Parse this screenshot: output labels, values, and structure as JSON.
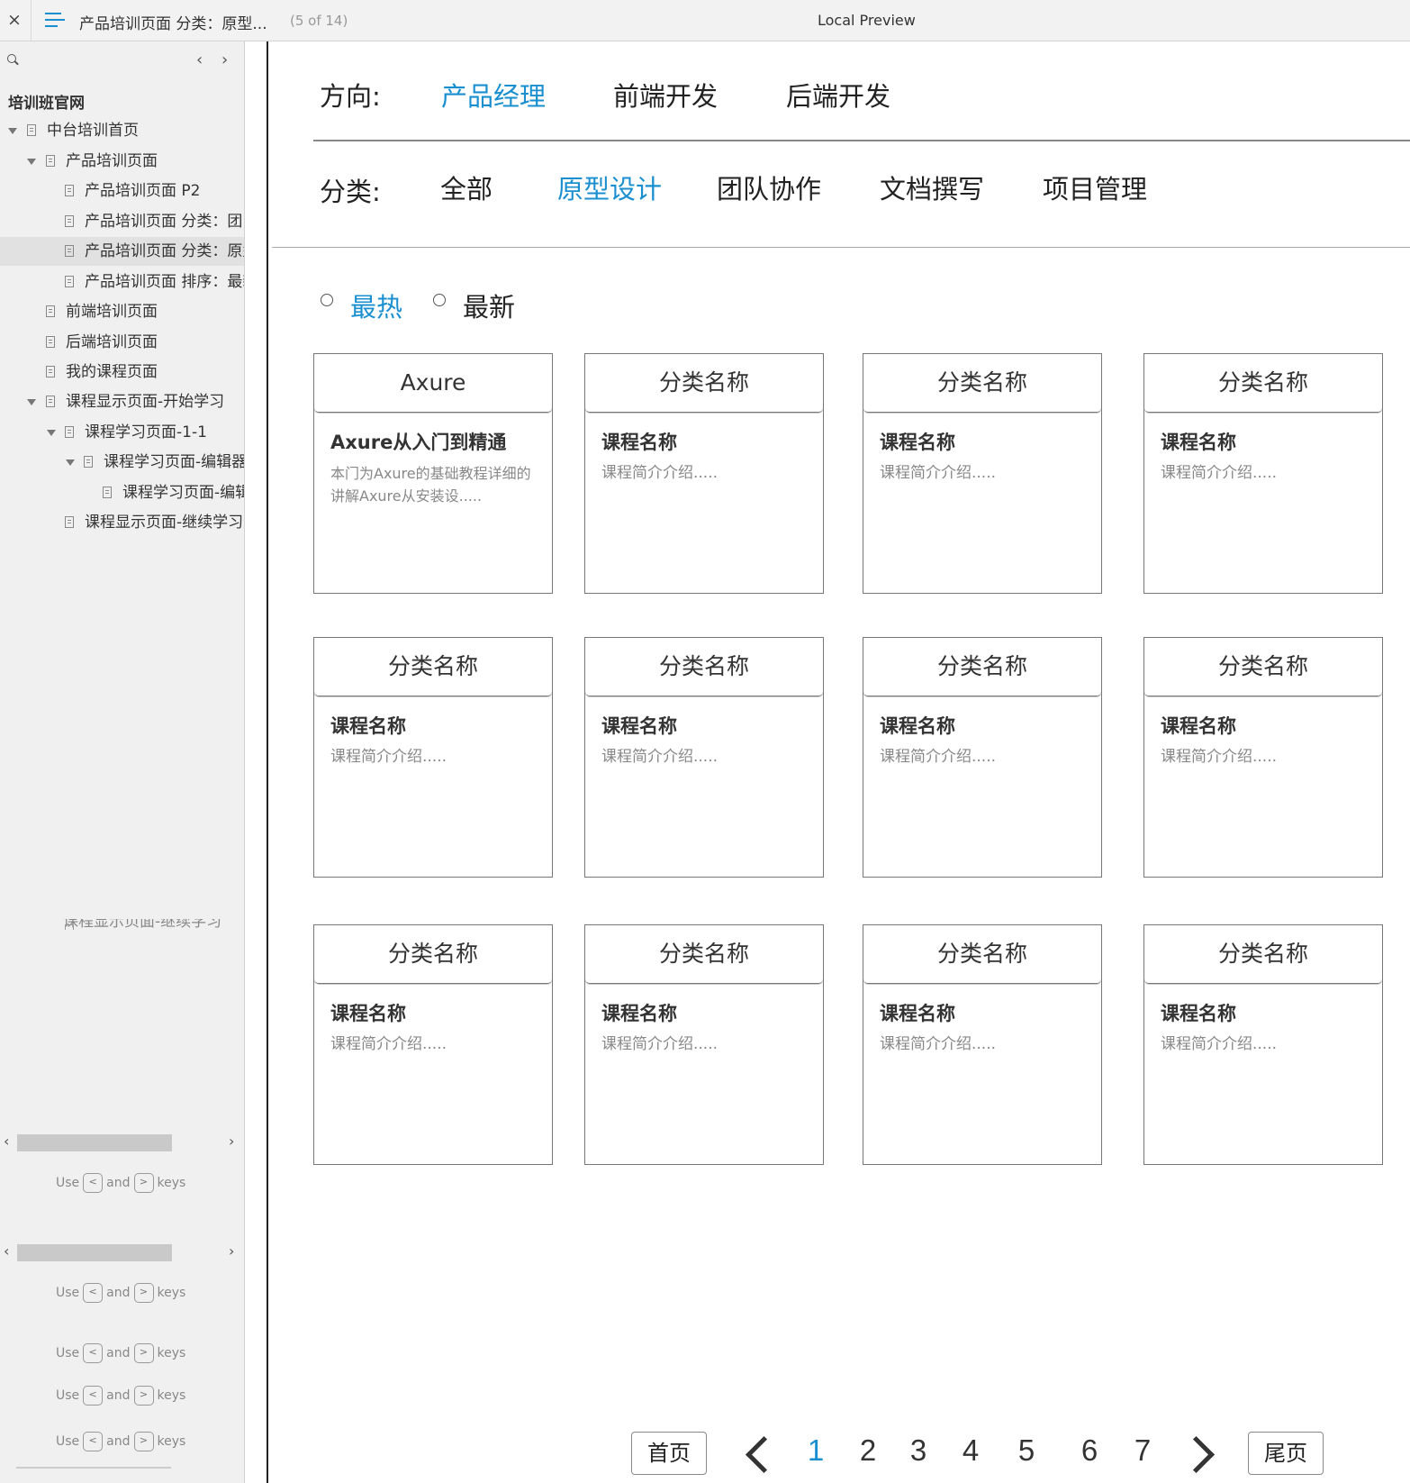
{
  "topbar": {
    "close_glyph": "×",
    "title": "产品培训页面 分类：原型...",
    "count": "(5 of 14)",
    "preview": "Local Preview",
    "menu_icon": "hamburger-icon"
  },
  "sidebar": {
    "root": "培训班官网",
    "items": [
      {
        "label": "中台培训首页"
      },
      {
        "label": "产品培训页面"
      },
      {
        "label": "产品培训页面 P2"
      },
      {
        "label": "产品培训页面 分类：团队协作"
      },
      {
        "label": "产品培训页面 分类：原型设计"
      },
      {
        "label": "产品培训页面 排序：最新"
      },
      {
        "label": "前端培训页面"
      },
      {
        "label": "后端培训页面"
      },
      {
        "label": "我的课程页面"
      },
      {
        "label": "课程显示页面-开始学习"
      },
      {
        "label": "课程学习页面-1-1"
      },
      {
        "label": "课程学习页面-编辑器"
      },
      {
        "label": "课程学习页面-编辑器"
      },
      {
        "label": "课程显示页面-继续学习"
      }
    ],
    "ghost_label": "课程显示页面-继续学习",
    "hint": {
      "use": "Use",
      "and": "and",
      "keys": "keys",
      "key_left": "<",
      "key_right": ">"
    }
  },
  "main": {
    "direction_label": "方向:",
    "directions": [
      "产品经理",
      "前端开发",
      "后端开发"
    ],
    "direction_active": "产品经理",
    "category_label": "分类:",
    "categories": [
      "全部",
      "原型设计",
      "团队协作",
      "文档撰写",
      "项目管理"
    ],
    "category_active": "原型设计",
    "sort": [
      "最热",
      "最新"
    ],
    "sort_active": "最热",
    "cards": [
      {
        "category": "Axure",
        "title": "Axure从入门到精通",
        "desc": "本门为Axure的基础教程详细的讲解Axure从安装设....."
      },
      {
        "category": "分类名称",
        "title": "课程名称",
        "desc": "课程简介介绍....."
      },
      {
        "category": "分类名称",
        "title": "课程名称",
        "desc": "课程简介介绍....."
      },
      {
        "category": "分类名称",
        "title": "课程名称",
        "desc": "课程简介介绍....."
      },
      {
        "category": "分类名称",
        "title": "课程名称",
        "desc": "课程简介介绍....."
      },
      {
        "category": "分类名称",
        "title": "课程名称",
        "desc": "课程简介介绍....."
      },
      {
        "category": "分类名称",
        "title": "课程名称",
        "desc": "课程简介介绍....."
      },
      {
        "category": "分类名称",
        "title": "课程名称",
        "desc": "课程简介介绍....."
      },
      {
        "category": "分类名称",
        "title": "课程名称",
        "desc": "课程简介介绍....."
      },
      {
        "category": "分类名称",
        "title": "课程名称",
        "desc": "课程简介介绍....."
      },
      {
        "category": "分类名称",
        "title": "课程名称",
        "desc": "课程简介介绍....."
      },
      {
        "category": "分类名称",
        "title": "课程名称",
        "desc": "课程简介介绍....."
      }
    ]
  },
  "pagination": {
    "first": "首页",
    "last": "尾页",
    "pages": [
      "1",
      "2",
      "3",
      "4",
      "5",
      "6",
      "7"
    ],
    "active": "1"
  },
  "colors": {
    "accent": "#1a8fd0",
    "text": "#333333",
    "muted": "#888888",
    "sidebar_bg": "#f0f0f0"
  }
}
